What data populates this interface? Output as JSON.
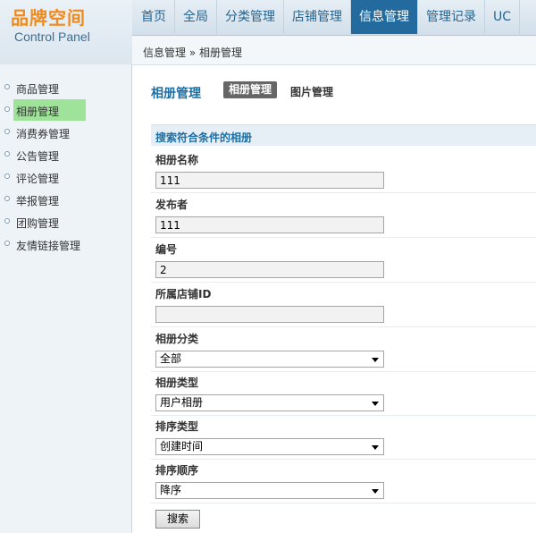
{
  "logo": {
    "title": "品牌空间",
    "subtitle": "Control Panel"
  },
  "nav": [
    "首页",
    "全局",
    "分类管理",
    "店铺管理",
    "信息管理",
    "管理记录",
    "UC"
  ],
  "nav_active_index": 4,
  "breadcrumb": "信息管理 » 相册管理",
  "sidebar": {
    "items": [
      {
        "label": "商品管理"
      },
      {
        "label": "相册管理"
      },
      {
        "label": "消费券管理"
      },
      {
        "label": "公告管理"
      },
      {
        "label": "评论管理"
      },
      {
        "label": "举报管理"
      },
      {
        "label": "团购管理"
      },
      {
        "label": "友情链接管理"
      }
    ],
    "active_index": 1
  },
  "page": {
    "title": "相册管理",
    "tabs": [
      {
        "label": "相册管理"
      },
      {
        "label": "图片管理"
      }
    ],
    "active_tab": 0
  },
  "search_form": {
    "section_title": "搜索符合条件的相册",
    "album_name": {
      "label": "相册名称",
      "value": "111"
    },
    "publisher": {
      "label": "发布者",
      "value": "111"
    },
    "number": {
      "label": "编号",
      "value": "2"
    },
    "store_id": {
      "label": "所属店铺ID",
      "value": ""
    },
    "album_category": {
      "label": "相册分类",
      "value": "全部"
    },
    "album_type": {
      "label": "相册类型",
      "value": "用户相册"
    },
    "sort_type": {
      "label": "排序类型",
      "value": "创建时间"
    },
    "sort_order": {
      "label": "排序顺序",
      "value": "降序"
    },
    "submit_label": "搜索"
  },
  "colors": {
    "accent": "#236b9f",
    "logo_orange": "#f08a1c",
    "sidebar_highlight": "#9fe39a",
    "section_bg": "#e6eff6"
  }
}
